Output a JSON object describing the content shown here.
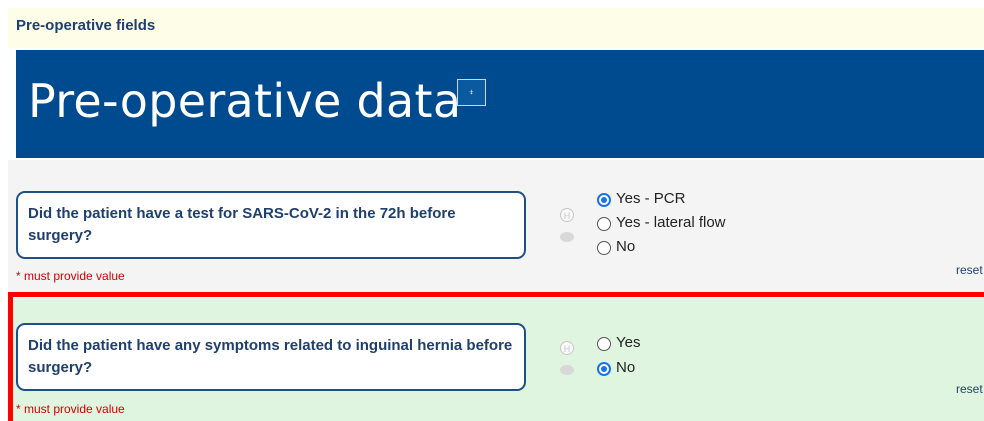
{
  "section": {
    "title": "Pre-operative fields"
  },
  "banner": {
    "title": "Pre-operative data",
    "button_icon": "pin-icon",
    "button_glyph": "⍖"
  },
  "questions": [
    {
      "label": "Did the patient have a test for SARS-CoV-2 in the 72h before surgery?",
      "required_note": "* must provide value",
      "options": [
        {
          "label": "Yes - PCR",
          "selected": true
        },
        {
          "label": "Yes - lateral flow",
          "selected": false
        },
        {
          "label": "No",
          "selected": false
        }
      ],
      "reset_label": "reset"
    },
    {
      "label": "Did the patient have any symptoms related to inguinal hernia before surgery?",
      "required_note": "* must provide value",
      "options": [
        {
          "label": "Yes",
          "selected": false
        },
        {
          "label": "No",
          "selected": true
        }
      ],
      "reset_label": "reset"
    }
  ],
  "aux_icons": {
    "history_glyph": "H",
    "history_icon": "history-icon",
    "comment_icon": "comment-icon"
  },
  "colors": {
    "banner": "#004a8f",
    "accent": "#1a73e8",
    "required": "#d40000",
    "highlight_border": "#ff0000",
    "row_highlight_bg": "#dff5df"
  }
}
